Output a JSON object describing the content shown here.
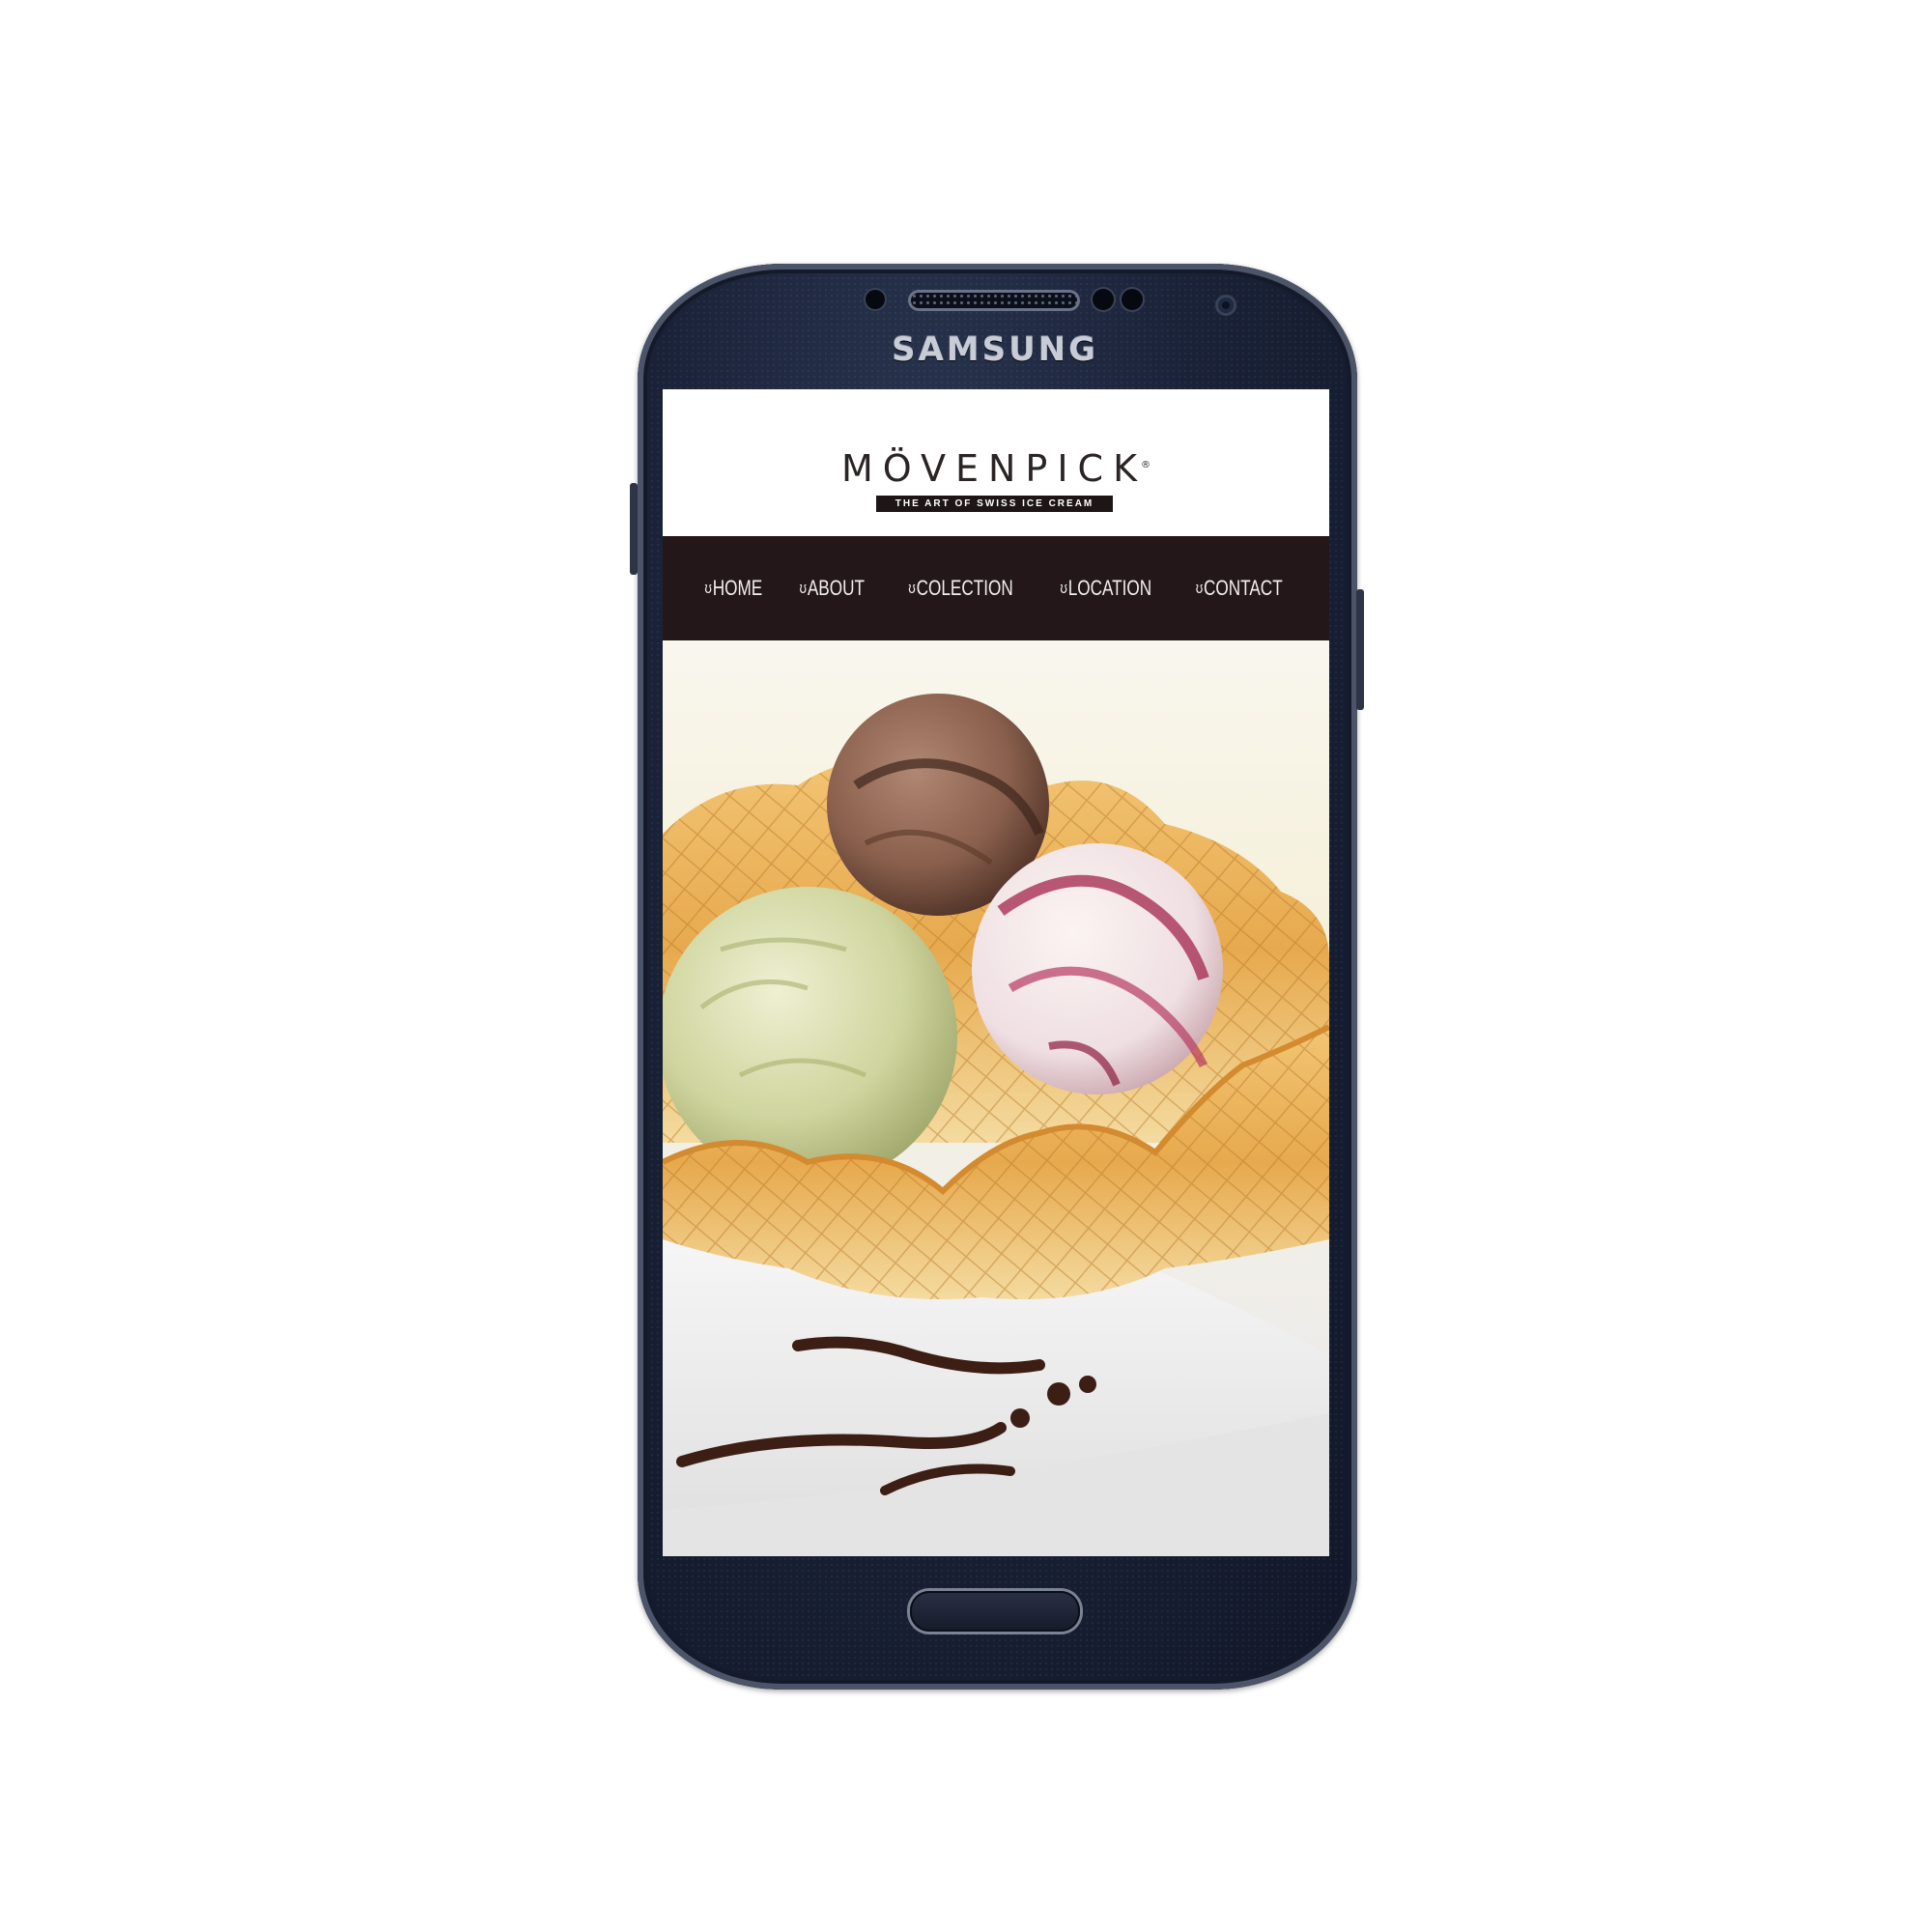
{
  "device": {
    "brand_label": "SAMSUNG"
  },
  "site": {
    "logo": {
      "wordmark": "MÖVENPICK",
      "registered_mark": "®",
      "tagline": "THE ART OF SWISS ICE CREAM"
    },
    "nav": {
      "items": [
        {
          "icon": "ʊ",
          "label": "HOME"
        },
        {
          "icon": "ʊ",
          "label": "ABOUT"
        },
        {
          "icon": "ʊ",
          "label": "COLECTION"
        },
        {
          "icon": "ʊ",
          "label": "LOCATION"
        },
        {
          "icon": "ʊ",
          "label": "CONTACT"
        }
      ]
    },
    "hero": {
      "image": "ice-cream-waffle-bowl-photo"
    }
  },
  "colors": {
    "nav_background": "#231719",
    "tagline_background": "#1e1616",
    "phone_body": "#1a2238"
  }
}
